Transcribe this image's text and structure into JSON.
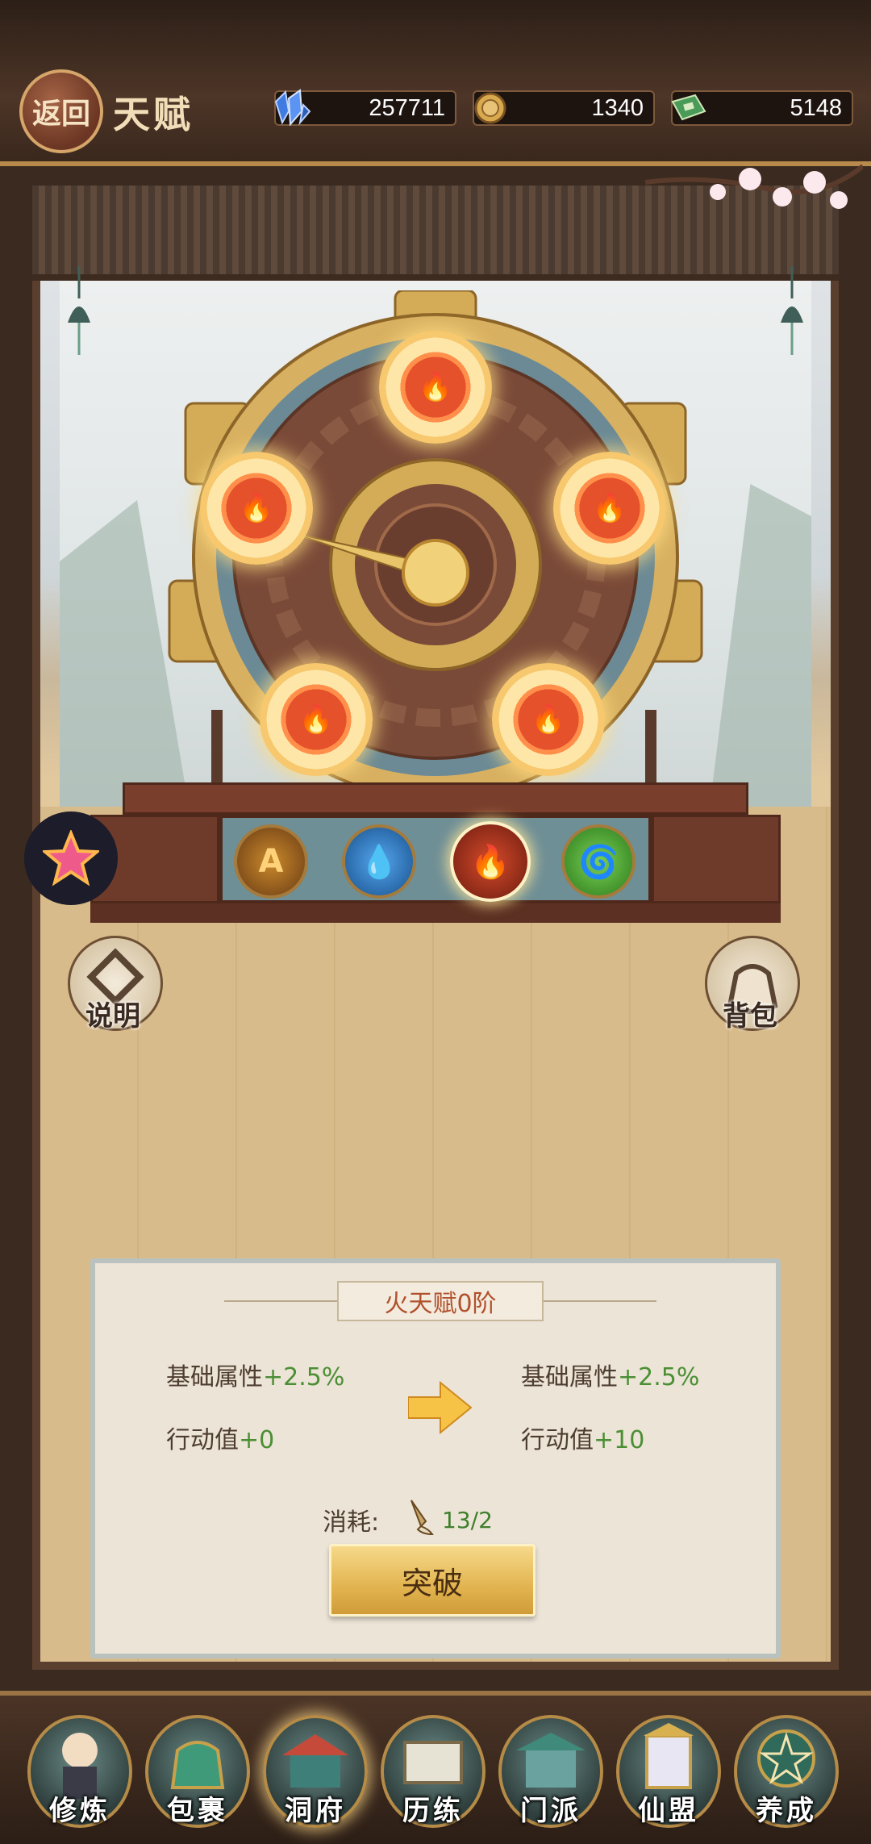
{
  "header": {
    "back_label": "返回",
    "title": "天赋",
    "resources": [
      {
        "icon": "crystal-icon",
        "value": "257711"
      },
      {
        "icon": "coin-icon",
        "value": "1340"
      },
      {
        "icon": "jade-book-icon",
        "value": "5148"
      }
    ]
  },
  "wheel": {
    "slots": [
      "fire-icon",
      "fire-icon",
      "fire-icon",
      "fire-icon",
      "fire-icon"
    ],
    "elements": [
      {
        "icon": "earth-element-icon",
        "selected": false
      },
      {
        "icon": "water-element-icon",
        "selected": false
      },
      {
        "icon": "fire-element-icon",
        "selected": true
      },
      {
        "icon": "wind-element-icon",
        "selected": false
      }
    ]
  },
  "side": {
    "help_label": "说明",
    "bag_label": "背包"
  },
  "panel": {
    "title": "火天赋0阶",
    "current": {
      "base_label": "基础属性",
      "base_value": "+2.5%",
      "action_label": "行动值",
      "action_value": "+0"
    },
    "next": {
      "base_label": "基础属性",
      "base_value": "+2.5%",
      "action_label": "行动值",
      "action_value": "+10"
    },
    "cost_label": "消耗:",
    "cost_value": "13/2",
    "break_label": "突破"
  },
  "nav": {
    "items": [
      {
        "label": "修炼"
      },
      {
        "label": "包裹"
      },
      {
        "label": "洞府"
      },
      {
        "label": "历练"
      },
      {
        "label": "门派"
      },
      {
        "label": "仙盟"
      },
      {
        "label": "养成"
      }
    ]
  },
  "colors": {
    "accent_gold": "#e2b450",
    "plus_green": "#4b8f35",
    "title_red": "#b0502c"
  }
}
